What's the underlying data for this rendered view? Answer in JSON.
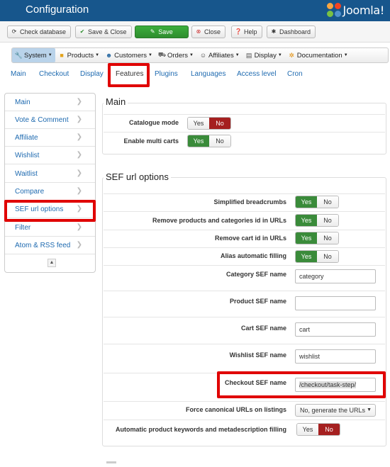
{
  "header": {
    "title": "Configuration",
    "logo_text": "Joomla!"
  },
  "toolbar": {
    "check_database": "Check database",
    "save_close": "Save & Close",
    "save": "Save",
    "close": "Close",
    "help": "Help",
    "dashboard": "Dashboard"
  },
  "menu": [
    {
      "label": "System",
      "icon": "wrench-icon"
    },
    {
      "label": "Products",
      "icon": "folder-icon"
    },
    {
      "label": "Customers",
      "icon": "users-icon"
    },
    {
      "label": "Orders",
      "icon": "cart-icon"
    },
    {
      "label": "Affiliates",
      "icon": "affiliate-icon"
    },
    {
      "label": "Display",
      "icon": "display-icon"
    },
    {
      "label": "Documentation",
      "icon": "lifebuoy-icon"
    }
  ],
  "tabs": [
    "Main",
    "Checkout",
    "Display",
    "Features",
    "Plugins",
    "Languages",
    "Access level",
    "Cron"
  ],
  "active_tab": "Features",
  "sidebar": {
    "items": [
      "Main",
      "Vote & Comment",
      "Affiliate",
      "Wishlist",
      "Waitlist",
      "Compare",
      "SEF url options",
      "Filter",
      "Atom & RSS feed"
    ],
    "active": "SEF url options"
  },
  "main_section": {
    "title": "Main",
    "catalogue_mode": {
      "label": "Catalogue mode",
      "yes": "Yes",
      "no": "No",
      "value": "No"
    },
    "multi_carts": {
      "label": "Enable multi carts",
      "yes": "Yes",
      "no": "No",
      "value": "Yes"
    }
  },
  "sef_section": {
    "title": "SEF url options",
    "simplified_breadcrumbs": {
      "label": "Simplified breadcrumbs",
      "yes": "Yes",
      "no": "No",
      "value": "Yes"
    },
    "remove_ids": {
      "label": "Remove products and categories id in URLs",
      "yes": "Yes",
      "no": "No",
      "value": "Yes"
    },
    "remove_cart_id": {
      "label": "Remove cart id in URLs",
      "yes": "Yes",
      "no": "No",
      "value": "Yes"
    },
    "alias_filling": {
      "label": "Alias automatic filling",
      "yes": "Yes",
      "no": "No",
      "value": "Yes"
    },
    "category_sef": {
      "label": "Category SEF name",
      "value": "category"
    },
    "product_sef": {
      "label": "Product SEF name",
      "value": ""
    },
    "cart_sef": {
      "label": "Cart SEF name",
      "value": "cart"
    },
    "wishlist_sef": {
      "label": "Wishlist SEF name",
      "value": "wishlist"
    },
    "checkout_sef": {
      "label": "Checkout SEF name",
      "value": "/checkout/task-step/"
    },
    "force_canonical": {
      "label": "Force canonical URLs on listings",
      "value": "No, generate the URLs"
    },
    "auto_keywords": {
      "label": "Automatic product keywords and metadescription filling",
      "yes": "Yes",
      "no": "No",
      "value": "No"
    }
  },
  "colors": {
    "header_bg": "#17568c",
    "link": "#1e6ab0",
    "green": "#3a8b3a",
    "red": "#a52020",
    "highlight": "#e00000"
  }
}
